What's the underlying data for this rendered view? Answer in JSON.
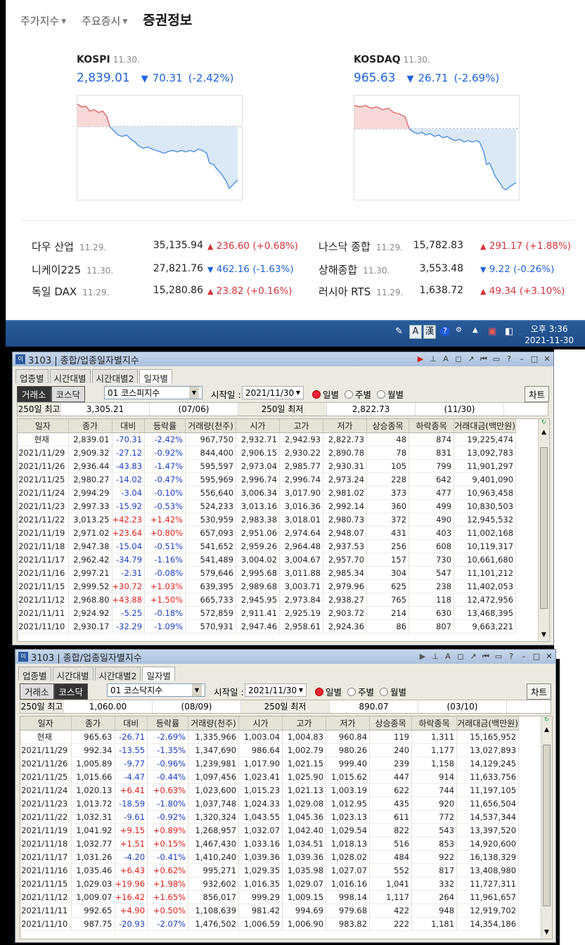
{
  "top_tabs": [
    {
      "label": "주가지수",
      "caret": true
    },
    {
      "label": "주요증시",
      "caret": true
    },
    {
      "label": "증권정보",
      "caret": false
    }
  ],
  "kospi": {
    "name": "KOSPI",
    "date": "11.30.",
    "value": "2,839.01",
    "arrow": "▼",
    "change": "70.31",
    "pct": "(-2.42%)"
  },
  "kosdaq": {
    "name": "KOSDAQ",
    "date": "11.30.",
    "value": "965.63",
    "arrow": "▼",
    "change": "26.71",
    "pct": "(-2.69%)"
  },
  "world": [
    {
      "name": "다우 산업",
      "date": "11.29.",
      "value": "35,135.94",
      "arrow": "▲",
      "change": "236.60",
      "pct": "(+0.68%)",
      "dir": "up"
    },
    {
      "name": "니케이225",
      "date": "11.30.",
      "value": "27,821.76",
      "arrow": "▼",
      "change": "462.16",
      "pct": "(-1.63%)",
      "dir": "dn"
    },
    {
      "name": "독일 DAX",
      "date": "11.29.",
      "value": "15,280.86",
      "arrow": "▲",
      "change": "23.82",
      "pct": "(+0.16%)",
      "dir": "up"
    },
    {
      "name": "나스닥 종합",
      "date": "11.29.",
      "value": "15,782.83",
      "arrow": "▲",
      "change": "291.17",
      "pct": "(+1.88%)",
      "dir": "up"
    },
    {
      "name": "상해종합",
      "date": "11.30.",
      "value": "3,553.48",
      "arrow": "▼",
      "change": "9.22",
      "pct": "(-0.26%)",
      "dir": "dn"
    },
    {
      "name": "러시아 RTS",
      "date": "11.29.",
      "value": "1,638.72",
      "arrow": "▲",
      "change": "49.34",
      "pct": "(+3.10%)",
      "dir": "up"
    }
  ],
  "taskbar": {
    "time": "오후 3:36",
    "date": "2021-11-30",
    "ime_a": "A",
    "ime_han": "漢"
  },
  "windows": [
    {
      "title": "3103 | 종합/업종일자별지수",
      "tabs": [
        "업종별",
        "시간대별",
        "시간대별2",
        "일자별"
      ],
      "market_buttons": [
        "거래소",
        "코스닥"
      ],
      "market_on": 0,
      "index_select": "01  코스피지수",
      "start_label": "시작일 :",
      "start_date": "2021/11/30",
      "radios": [
        "일별",
        "주별",
        "월별"
      ],
      "chart_btn": "차트",
      "summary": [
        "250일 최고",
        "3,305.21",
        "(07/06)",
        "250일 최저",
        "2,822.73",
        "(11/30)"
      ],
      "columns": [
        "일자",
        "종가",
        "대비",
        "등락률",
        "거래량(천주)",
        "시가",
        "고가",
        "저가",
        "상승종목",
        "하락종목",
        "거래대금(백만원)"
      ],
      "rows": [
        [
          "현재",
          "2,839.01",
          "-70.31",
          "-2.42%",
          "967,750",
          "2,932.71",
          "2,942.93",
          "2,822.73",
          "48",
          "874",
          "19,225,474"
        ],
        [
          "2021/11/29",
          "2,909.32",
          "-27.12",
          "-0.92%",
          "844,400",
          "2,906.15",
          "2,930.22",
          "2,890.78",
          "78",
          "831",
          "13,092,783"
        ],
        [
          "2021/11/26",
          "2,936.44",
          "-43.83",
          "-1.47%",
          "595,597",
          "2,973.04",
          "2,985.77",
          "2,930.31",
          "105",
          "799",
          "11,901,297"
        ],
        [
          "2021/11/25",
          "2,980.27",
          "-14.02",
          "-0.47%",
          "595,969",
          "2,996.74",
          "2,996.74",
          "2,973.24",
          "228",
          "642",
          "9,401,090"
        ],
        [
          "2021/11/24",
          "2,994.29",
          "-3.04",
          "-0.10%",
          "556,640",
          "3,006.34",
          "3,017.90",
          "2,981.02",
          "373",
          "477",
          "10,963,458"
        ],
        [
          "2021/11/23",
          "2,997.33",
          "-15.92",
          "-0.53%",
          "524,233",
          "3,013.16",
          "3,016.36",
          "2,992.14",
          "360",
          "499",
          "10,830,503"
        ],
        [
          "2021/11/22",
          "3,013.25",
          "+42.23",
          "+1.42%",
          "530,959",
          "2,983.38",
          "3,018.01",
          "2,980.73",
          "372",
          "490",
          "12,945,532"
        ],
        [
          "2021/11/19",
          "2,971.02",
          "+23.64",
          "+0.80%",
          "657,093",
          "2,951.06",
          "2,974.64",
          "2,948.07",
          "431",
          "403",
          "11,002,168"
        ],
        [
          "2021/11/18",
          "2,947.38",
          "-15.04",
          "-0.51%",
          "541,652",
          "2,959.26",
          "2,964.48",
          "2,937.53",
          "256",
          "608",
          "10,119,317"
        ],
        [
          "2021/11/17",
          "2,962.42",
          "-34.79",
          "-1.16%",
          "541,489",
          "3,004.02",
          "3,004.67",
          "2,957.70",
          "157",
          "730",
          "10,661,680"
        ],
        [
          "2021/11/16",
          "2,997.21",
          "-2.31",
          "-0.08%",
          "579,646",
          "2,995.68",
          "3,011.88",
          "2,985.34",
          "304",
          "547",
          "11,101,212"
        ],
        [
          "2021/11/15",
          "2,999.52",
          "+30.72",
          "+1.03%",
          "639,395",
          "2,989.68",
          "3,003.71",
          "2,979.96",
          "625",
          "238",
          "11,402,053"
        ],
        [
          "2021/11/12",
          "2,968.80",
          "+43.88",
          "+1.50%",
          "665,733",
          "2,945.95",
          "2,973.84",
          "2,938.27",
          "765",
          "118",
          "12,472,956"
        ],
        [
          "2021/11/11",
          "2,924.92",
          "-5.25",
          "-0.18%",
          "572,859",
          "2,911.41",
          "2,925.19",
          "2,903.72",
          "214",
          "630",
          "13,468,395"
        ],
        [
          "2021/11/10",
          "2,930.17",
          "-32.29",
          "-1.09%",
          "570,931",
          "2,947.46",
          "2,958.61",
          "2,924.36",
          "86",
          "807",
          "9,663,221"
        ]
      ]
    },
    {
      "title": "3103 | 종합/업종일자별지수",
      "tabs": [
        "업종별",
        "시간대별",
        "시간대별2",
        "일자별"
      ],
      "market_buttons": [
        "거래소",
        "코스닥"
      ],
      "market_on": 1,
      "index_select": "01  코스닥지수",
      "start_label": "시작일 :",
      "start_date": "2021/11/30",
      "radios": [
        "일별",
        "주별",
        "월별"
      ],
      "chart_btn": "차트",
      "summary": [
        "250일 최고",
        "1,060.00",
        "(08/09)",
        "250일 최저",
        "890.07",
        "(03/10)"
      ],
      "columns": [
        "일자",
        "종가",
        "대비",
        "등락률",
        "거래량(천주)",
        "시가",
        "고가",
        "저가",
        "상승종목",
        "하락종목",
        "거래대금(백만원)"
      ],
      "rows": [
        [
          "현재",
          "965.63",
          "-26.71",
          "-2.69%",
          "1,335,966",
          "1,003.04",
          "1,004.83",
          "960.84",
          "119",
          "1,311",
          "15,165,952"
        ],
        [
          "2021/11/29",
          "992.34",
          "-13.55",
          "-1.35%",
          "1,347,690",
          "986.64",
          "1,002.79",
          "980.26",
          "240",
          "1,177",
          "13,027,893"
        ],
        [
          "2021/11/26",
          "1,005.89",
          "-9.77",
          "-0.96%",
          "1,239,981",
          "1,017.90",
          "1,021.15",
          "999.40",
          "239",
          "1,158",
          "14,129,245"
        ],
        [
          "2021/11/25",
          "1,015.66",
          "-4.47",
          "-0.44%",
          "1,097,456",
          "1,023.41",
          "1,025.90",
          "1,015.62",
          "447",
          "914",
          "11,633,756"
        ],
        [
          "2021/11/24",
          "1,020.13",
          "+6.41",
          "+0.63%",
          "1,023,600",
          "1,015.23",
          "1,021.13",
          "1,003.19",
          "622",
          "744",
          "11,197,105"
        ],
        [
          "2021/11/23",
          "1,013.72",
          "-18.59",
          "-1.80%",
          "1,037,748",
          "1,024.33",
          "1,029.08",
          "1,012.95",
          "435",
          "920",
          "11,656,504"
        ],
        [
          "2021/11/22",
          "1,032.31",
          "-9.61",
          "-0.92%",
          "1,320,324",
          "1,043.55",
          "1,045.36",
          "1,023.13",
          "611",
          "772",
          "14,537,344"
        ],
        [
          "2021/11/19",
          "1,041.92",
          "+9.15",
          "+0.89%",
          "1,268,957",
          "1,032.07",
          "1,042.40",
          "1,029.54",
          "822",
          "543",
          "13,397,520"
        ],
        [
          "2021/11/18",
          "1,032.77",
          "+1.51",
          "+0.15%",
          "1,467,430",
          "1,033.16",
          "1,034.51",
          "1,018.13",
          "516",
          "853",
          "14,920,600"
        ],
        [
          "2021/11/17",
          "1,031.26",
          "-4.20",
          "-0.41%",
          "1,410,240",
          "1,039.36",
          "1,039.36",
          "1,028.02",
          "484",
          "922",
          "16,138,329"
        ],
        [
          "2021/11/16",
          "1,035.46",
          "+6.43",
          "+0.62%",
          "995,271",
          "1,029.35",
          "1,035.98",
          "1,027.07",
          "552",
          "817",
          "13,408,980"
        ],
        [
          "2021/11/15",
          "1,029.03",
          "+19.96",
          "+1.98%",
          "932,602",
          "1,016.35",
          "1,029.07",
          "1,016.16",
          "1,041",
          "332",
          "11,727,311"
        ],
        [
          "2021/11/12",
          "1,009.07",
          "+16.42",
          "+1.65%",
          "856,017",
          "999.29",
          "1,009.15",
          "998.14",
          "1,117",
          "264",
          "11,961,657"
        ],
        [
          "2021/11/11",
          "992.65",
          "+4.90",
          "+0.50%",
          "1,108,639",
          "981.42",
          "994.69",
          "979.68",
          "422",
          "948",
          "12,919,702"
        ],
        [
          "2021/11/10",
          "987.75",
          "-20.93",
          "-2.07%",
          "1,476,502",
          "1,006.59",
          "1,006.90",
          "983.82",
          "222",
          "1,181",
          "14,354,186"
        ]
      ]
    }
  ]
}
